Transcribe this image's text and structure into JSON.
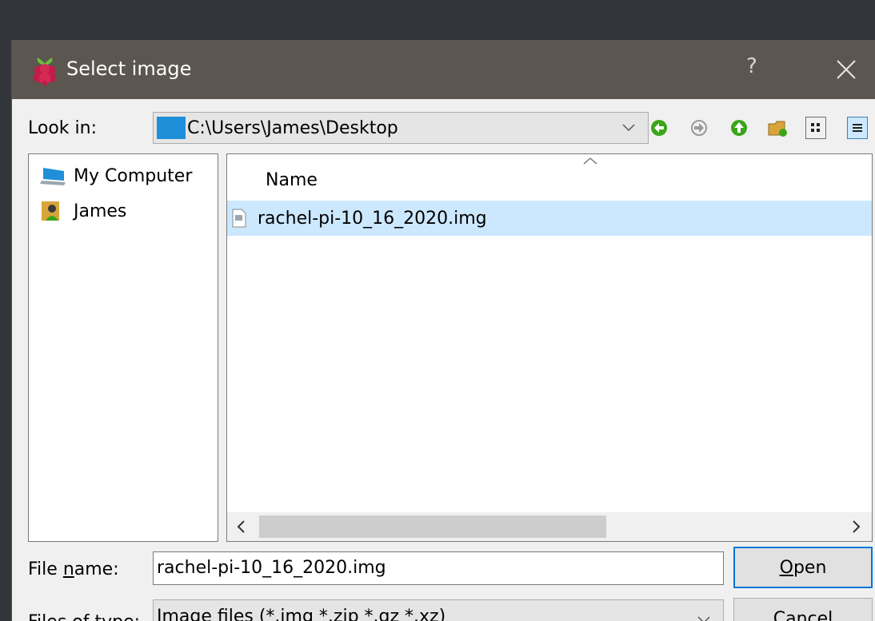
{
  "dialog": {
    "title": "Select image",
    "help_glyph": "?",
    "app_icon": "raspberry-icon",
    "close_icon": "close-icon"
  },
  "lookin": {
    "label": "Look in:",
    "path": "C:\\Users\\James\\Desktop"
  },
  "toolbar": {
    "icons": [
      "back-icon",
      "forward-icon",
      "up-icon",
      "new-folder-icon",
      "list-view-icon",
      "detail-view-icon"
    ]
  },
  "sidebar": {
    "items": [
      {
        "label": "My Computer",
        "icon": "computer-icon"
      },
      {
        "label": "James",
        "icon": "user-icon"
      }
    ]
  },
  "filelist": {
    "column_name": "Name",
    "files": [
      {
        "name": "rachel-pi-10_16_2020.img",
        "selected": true
      }
    ]
  },
  "filename": {
    "label_pre": "File ",
    "label_u": "n",
    "label_post": "ame:",
    "value": "rachel-pi-10_16_2020.img"
  },
  "filetype": {
    "label": "Files of type:",
    "value": "Image files (*.img *.zip *.gz *.xz)"
  },
  "buttons": {
    "open_u": "O",
    "open_rest": "pen",
    "cancel": "Cancel"
  },
  "colors": {
    "titlebar": "#5c5650",
    "selection": "#cce8ff",
    "accent": "#0078d7",
    "desktop": "#32363a"
  }
}
